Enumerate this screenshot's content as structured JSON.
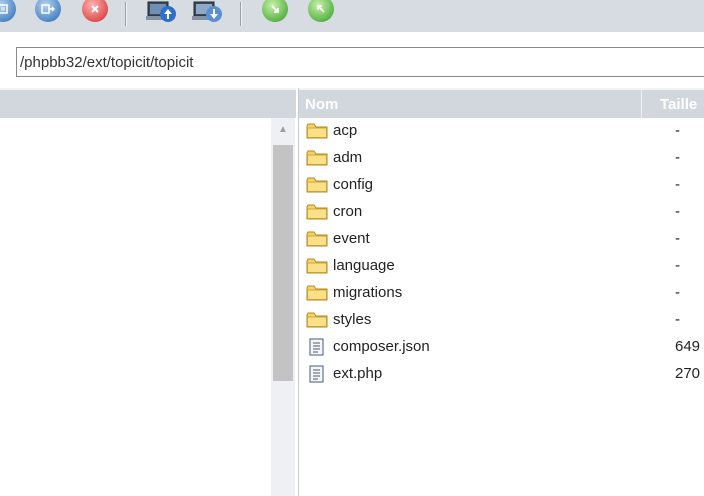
{
  "toolbar": {
    "buttons": [
      {
        "name": "list-view",
        "icon": "list-icon"
      },
      {
        "name": "export",
        "icon": "export-icon"
      },
      {
        "name": "cancel",
        "icon": "cancel-icon"
      },
      {
        "name": "upload",
        "icon": "upload-icon"
      },
      {
        "name": "download",
        "icon": "download-icon"
      },
      {
        "name": "green-action-1",
        "icon": "compress-icon"
      },
      {
        "name": "green-action-2",
        "icon": "expand-icon"
      }
    ]
  },
  "pathbar": {
    "value": "/phpbb32/ext/topicit/topicit"
  },
  "columns": {
    "name": "Nom",
    "size": "Taille"
  },
  "files": [
    {
      "name": "acp",
      "size": "-",
      "type": "folder"
    },
    {
      "name": "adm",
      "size": "-",
      "type": "folder"
    },
    {
      "name": "config",
      "size": "-",
      "type": "folder"
    },
    {
      "name": "cron",
      "size": "-",
      "type": "folder"
    },
    {
      "name": "event",
      "size": "-",
      "type": "folder"
    },
    {
      "name": "language",
      "size": "-",
      "type": "folder"
    },
    {
      "name": "migrations",
      "size": "-",
      "type": "folder"
    },
    {
      "name": "styles",
      "size": "-",
      "type": "folder"
    },
    {
      "name": "composer.json",
      "size": "649",
      "type": "file"
    },
    {
      "name": "ext.php",
      "size": "270",
      "type": "file"
    }
  ],
  "colors": {
    "toolbar_bg": "#d7dbe2",
    "header_bg": "#d2d6dd",
    "folder": "#f6d36a"
  }
}
